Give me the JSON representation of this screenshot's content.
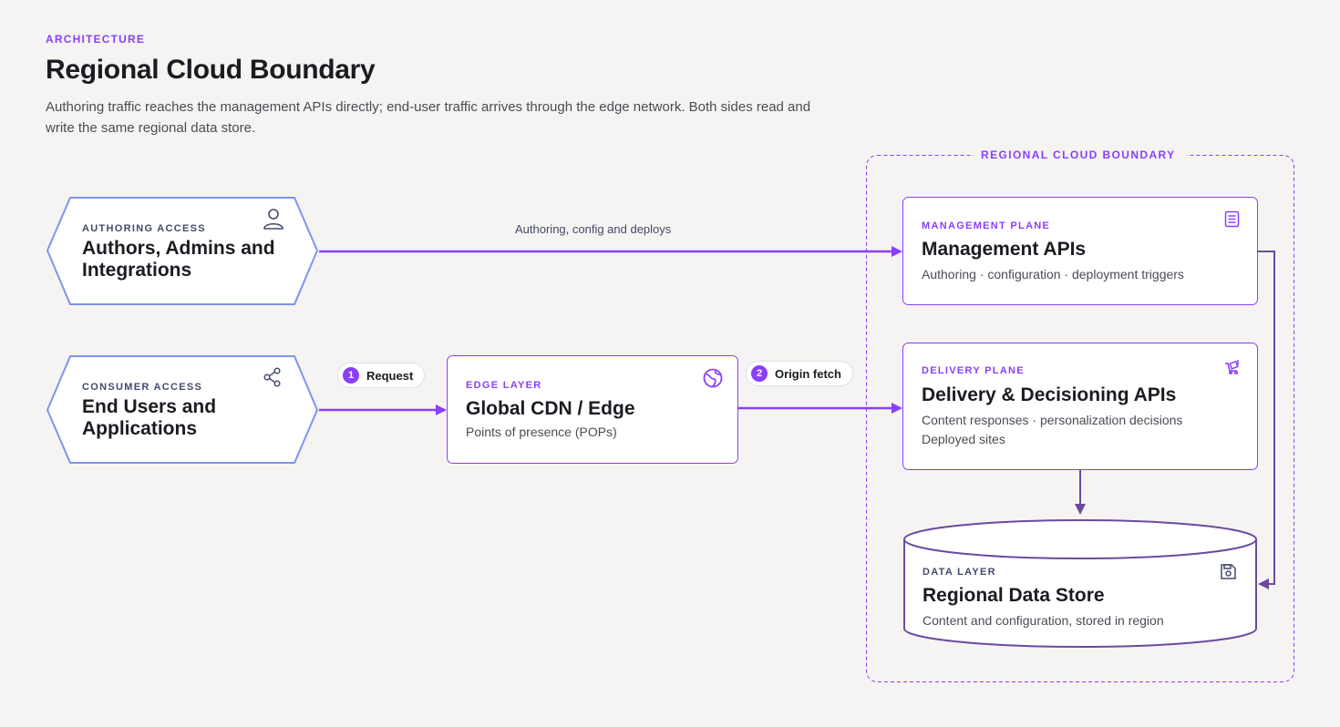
{
  "header": {
    "eyebrow": "ARCHITECTURE",
    "title": "Regional Cloud Boundary",
    "description": "Authoring traffic reaches the management APIs directly; end-user traffic arrives through the edge network. Both sides read and write the same regional data store."
  },
  "boundary": {
    "label": "REGIONAL CLOUD BOUNDARY"
  },
  "actors": {
    "authoring": {
      "label": "AUTHORING ACCESS",
      "title_line1": "Authors, Admins and",
      "title_line2": "Integrations",
      "icon": "user-icon"
    },
    "consumer": {
      "label": "CONSUMER ACCESS",
      "title_line1": "End Users and",
      "title_line2": "Applications",
      "icon": "share-icon"
    }
  },
  "nodes": {
    "edge": {
      "label": "EDGE LAYER",
      "title": "Global CDN / Edge",
      "subtitle": "Points of presence (POPs)",
      "icon": "globe-icon"
    },
    "management": {
      "label": "MANAGEMENT PLANE",
      "title": "Management APIs",
      "subtitle": "Authoring · configuration · deployment triggers",
      "icon": "document-icon"
    },
    "delivery": {
      "label": "DELIVERY PLANE",
      "title": "Delivery & Decisioning APIs",
      "subtitle_line1": "Content responses · personalization decisions",
      "subtitle_line2": "Deployed sites",
      "icon": "delivery-cart-icon"
    },
    "datastore": {
      "label": "DATA LAYER",
      "title": "Regional Data Store",
      "subtitle": "Content and configuration, stored in region",
      "icon": "save-icon"
    }
  },
  "edges": {
    "authoring_label": "Authoring, config and deploys",
    "request": {
      "num": "1",
      "label": "Request"
    },
    "origin": {
      "num": "2",
      "label": "Origin fetch"
    }
  },
  "colors": {
    "accent": "#8a3ffc",
    "actor_border": "#7f93f0",
    "node_border": "#8a3ffc",
    "datastore_border": "#6b4a9e",
    "background": "#f5f4f2"
  }
}
